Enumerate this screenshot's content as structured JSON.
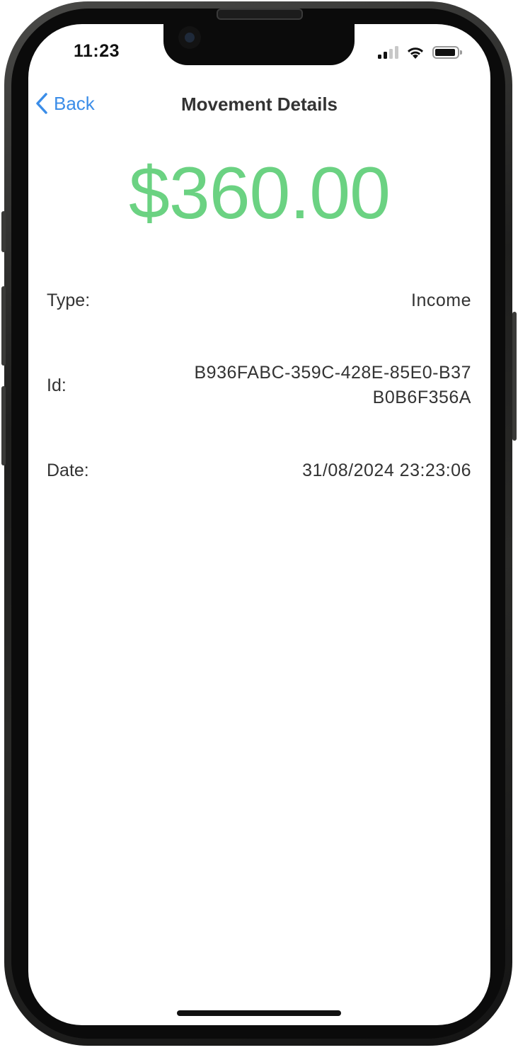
{
  "status_bar": {
    "time": "11:23",
    "icons": [
      "signal-icon",
      "wifi-icon",
      "battery-icon"
    ]
  },
  "nav": {
    "back_label": "Back",
    "title": "Movement Details"
  },
  "amount": {
    "value": "$360.00",
    "color": "#6bd282"
  },
  "details": {
    "type_label": "Type:",
    "type_value": "Income",
    "id_label": "Id:",
    "id_value": "B936FABC-359C-428E-85E0-B37B0B6F356A",
    "date_label": "Date:",
    "date_value": "31/08/2024 23:23:06"
  },
  "colors": {
    "accent": "#3b8de8",
    "text": "#333333"
  }
}
